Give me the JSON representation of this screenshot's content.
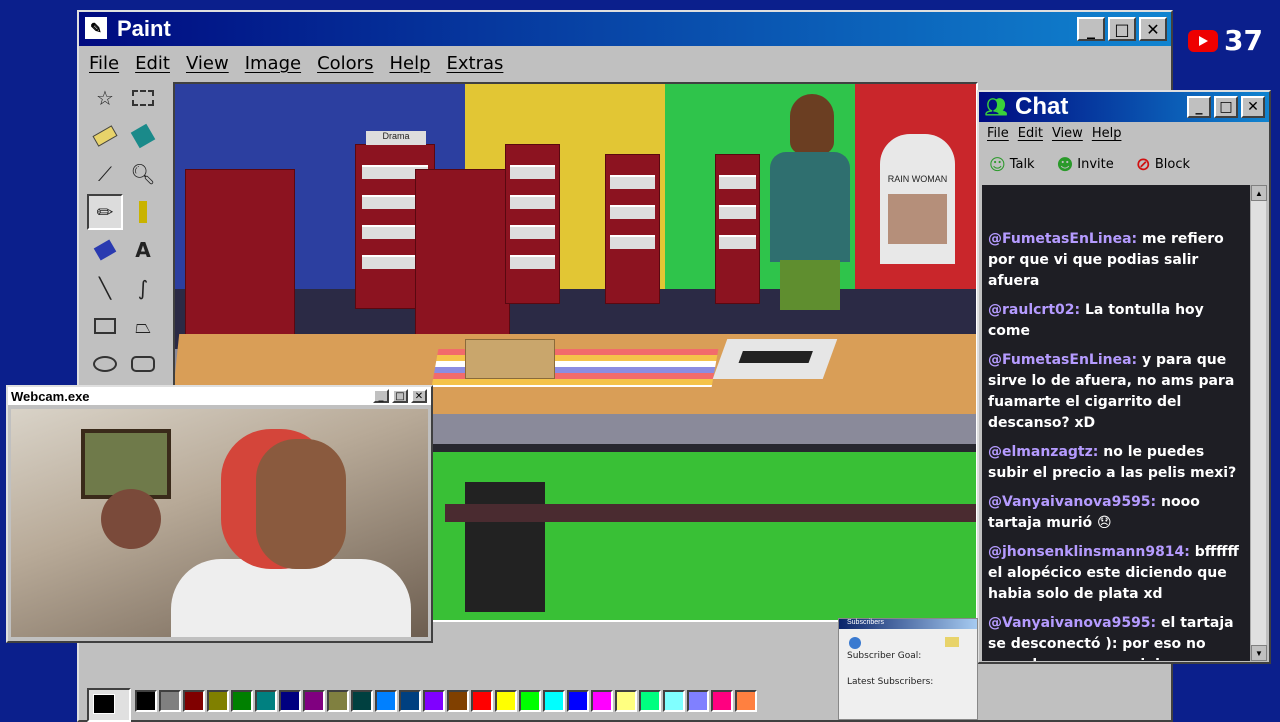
{
  "paint": {
    "title": "Paint",
    "menu": [
      "File",
      "Edit",
      "View",
      "Image",
      "Colors",
      "Help",
      "Extras"
    ],
    "tools": [
      "free-select",
      "rect-select",
      "eraser",
      "fill",
      "color-picker",
      "magnifier",
      "pencil",
      "brush",
      "airbrush",
      "text",
      "line",
      "curve",
      "rectangle",
      "polygon",
      "ellipse",
      "rounded-rect"
    ],
    "palette": [
      "#000000",
      "#808080",
      "#800000",
      "#808000",
      "#008000",
      "#008080",
      "#000080",
      "#800080",
      "#808040",
      "#004040",
      "#0080ff",
      "#004080",
      "#8000ff",
      "#804000",
      "#ff0000",
      "#ffff00",
      "#00ff00",
      "#00ffff",
      "#0000ff",
      "#ff00ff",
      "#ffff80",
      "#00ff80",
      "#80ffff",
      "#8080ff",
      "#ff0080",
      "#ff8040"
    ]
  },
  "webcam": {
    "title": "Webcam.exe"
  },
  "chat": {
    "title": "Chat",
    "menu": [
      "File",
      "Edit",
      "View",
      "Help"
    ],
    "toolbar": {
      "talk": "Talk",
      "invite": "Invite",
      "block": "Block"
    },
    "messages": [
      {
        "user": "@FumetasEnLinea:",
        "text": "me refiero por que vi que podias salir afuera"
      },
      {
        "user": "@raulcrt02:",
        "text": "La tontulla hoy come"
      },
      {
        "user": "@FumetasEnLinea:",
        "text": "y para que sirve lo de afuera, no ams para fuamarte el cigarrito del descanso? xD"
      },
      {
        "user": "@elmanzagtz:",
        "text": "no le puedes subir el precio a las pelis mexi?"
      },
      {
        "user": "@Vanyaivanova9595:",
        "text": "nooo tartaja murió 😞"
      },
      {
        "user": "@jhonsenklinsmann9814:",
        "text": "bffffff el alopécico este diciendo que habia solo de plata xd"
      },
      {
        "user": "@Vanyaivanova9595:",
        "text": "el tartaja se desconectó ): por eso no escuchamos sus opiniones"
      }
    ]
  },
  "subscribers": {
    "title": "Subscribers",
    "goal": "Subscriber Goal:",
    "latest": "Latest Subscribers:"
  },
  "badge": {
    "count": "37"
  },
  "scene": {
    "sign_drama": "Drama",
    "sign_poster": "RAIN WOMAN"
  }
}
